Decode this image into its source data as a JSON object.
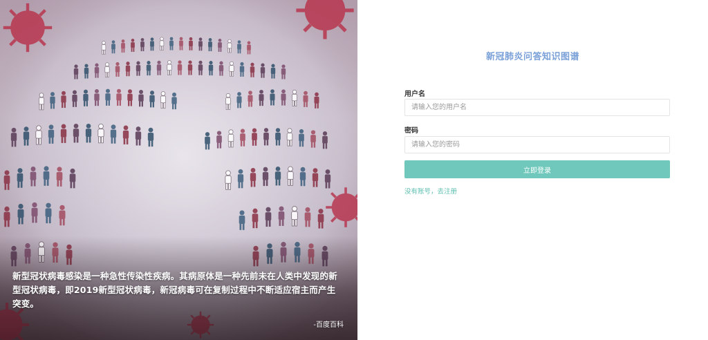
{
  "hero": {
    "caption": "新型冠状病毒感染是一种急性传染性疾病。其病原体是一种先前未在人类中发现的新型冠状病毒，即2019新型冠状病毒，新冠病毒可在复制过程中不断适应宿主而产生突变。",
    "source": "-百度百科"
  },
  "login": {
    "title": "新冠肺炎问答知识图谱",
    "username_label": "用户名",
    "username_placeholder": "请输入您的用户名",
    "password_label": "密码",
    "password_placeholder": "请输入您的密码",
    "submit_label": "立即登录",
    "register_link": "没有账号，去注册"
  },
  "colors": {
    "title": "#7aa0d8",
    "button": "#6fc8bb",
    "link": "#5dbfb0"
  }
}
